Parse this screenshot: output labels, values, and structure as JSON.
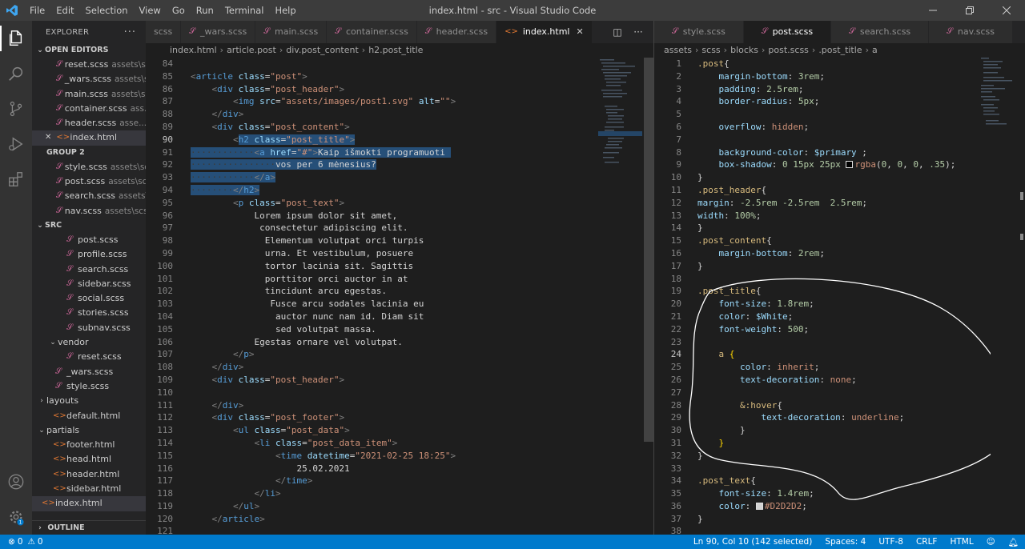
{
  "app": {
    "window_title": "index.html - src - Visual Studio Code",
    "menu": [
      "File",
      "Edit",
      "Selection",
      "View",
      "Go",
      "Run",
      "Terminal",
      "Help"
    ]
  },
  "sidebar": {
    "explorer_label": "EXPLORER",
    "open_editors_label": "OPEN EDITORS",
    "open_editors": [
      {
        "name": "reset.scss",
        "desc": "assets\\s...",
        "type": "scss"
      },
      {
        "name": "_wars.scss",
        "desc": "assets\\s...",
        "type": "scss"
      },
      {
        "name": "main.scss",
        "desc": "assets\\s...",
        "type": "scss"
      },
      {
        "name": "container.scss",
        "desc": "ass...",
        "type": "scss"
      },
      {
        "name": "header.scss",
        "desc": "asse...",
        "type": "scss"
      },
      {
        "name": "index.html",
        "desc": "",
        "type": "html"
      }
    ],
    "group2_label": "GROUP 2",
    "group2": [
      {
        "name": "style.scss",
        "desc": "assets\\scss",
        "type": "scss"
      },
      {
        "name": "post.scss",
        "desc": "assets\\sc...",
        "type": "scss"
      },
      {
        "name": "search.scss",
        "desc": "assets\\...",
        "type": "scss"
      },
      {
        "name": "nav.scss",
        "desc": "assets\\scs...",
        "type": "scss"
      }
    ],
    "src_label": "SRC",
    "src_files": [
      {
        "name": "post.scss",
        "type": "scss",
        "indent": 2
      },
      {
        "name": "profile.scss",
        "type": "scss",
        "indent": 2
      },
      {
        "name": "search.scss",
        "type": "scss",
        "indent": 2
      },
      {
        "name": "sidebar.scss",
        "type": "scss",
        "indent": 2
      },
      {
        "name": "social.scss",
        "type": "scss",
        "indent": 2
      },
      {
        "name": "stories.scss",
        "type": "scss",
        "indent": 2
      },
      {
        "name": "subnav.scss",
        "type": "scss",
        "indent": 2
      },
      {
        "name": "vendor",
        "type": "folder",
        "indent": 1
      },
      {
        "name": "reset.scss",
        "type": "scss",
        "indent": 2
      },
      {
        "name": "_wars.scss",
        "type": "scss",
        "indent": 1
      },
      {
        "name": "style.scss",
        "type": "scss",
        "indent": 1
      },
      {
        "name": "layouts",
        "type": "folder-closed",
        "indent": 0
      },
      {
        "name": "default.html",
        "type": "html",
        "indent": 1
      },
      {
        "name": "partials",
        "type": "folder",
        "indent": 0
      },
      {
        "name": "footer.html",
        "type": "html",
        "indent": 1
      },
      {
        "name": "head.html",
        "type": "html",
        "indent": 1
      },
      {
        "name": "header.html",
        "type": "html",
        "indent": 1
      },
      {
        "name": "sidebar.html",
        "type": "html",
        "indent": 1
      },
      {
        "name": "index.html",
        "type": "html",
        "indent": 0
      }
    ],
    "outline_label": "OUTLINE"
  },
  "editor1": {
    "tabs": [
      {
        "name": "scss",
        "type": "scss",
        "active": false
      },
      {
        "name": "_wars.scss",
        "type": "scss",
        "active": false
      },
      {
        "name": "main.scss",
        "type": "scss",
        "active": false
      },
      {
        "name": "container.scss",
        "type": "scss",
        "active": false
      },
      {
        "name": "header.scss",
        "type": "scss",
        "active": false
      },
      {
        "name": "index.html",
        "type": "html",
        "active": true
      }
    ],
    "breadcrumb": [
      "index.html",
      "article.post",
      "div.post_content",
      "h2.post_title"
    ],
    "first_line": 84
  },
  "editor2": {
    "tabs": [
      {
        "name": "style.scss",
        "type": "scss",
        "active": false
      },
      {
        "name": "post.scss",
        "type": "scss",
        "active": true
      },
      {
        "name": "search.scss",
        "type": "scss",
        "active": false
      },
      {
        "name": "nav.scss",
        "type": "scss",
        "active": false
      }
    ],
    "breadcrumb": [
      "assets",
      "scss",
      "blocks",
      "post.scss",
      ".post_title",
      "a"
    ],
    "first_line": 1
  },
  "statusbar": {
    "errors": "0",
    "warnings": "0",
    "position": "Ln 90, Col 10 (142 selected)",
    "spaces": "Spaces: 4",
    "encoding": "UTF-8",
    "eol": "CRLF",
    "language": "HTML"
  },
  "colors": {
    "accent": "#007acc",
    "primary_var_swatch": "#000000",
    "text_swatch": "#D2D2D2"
  }
}
